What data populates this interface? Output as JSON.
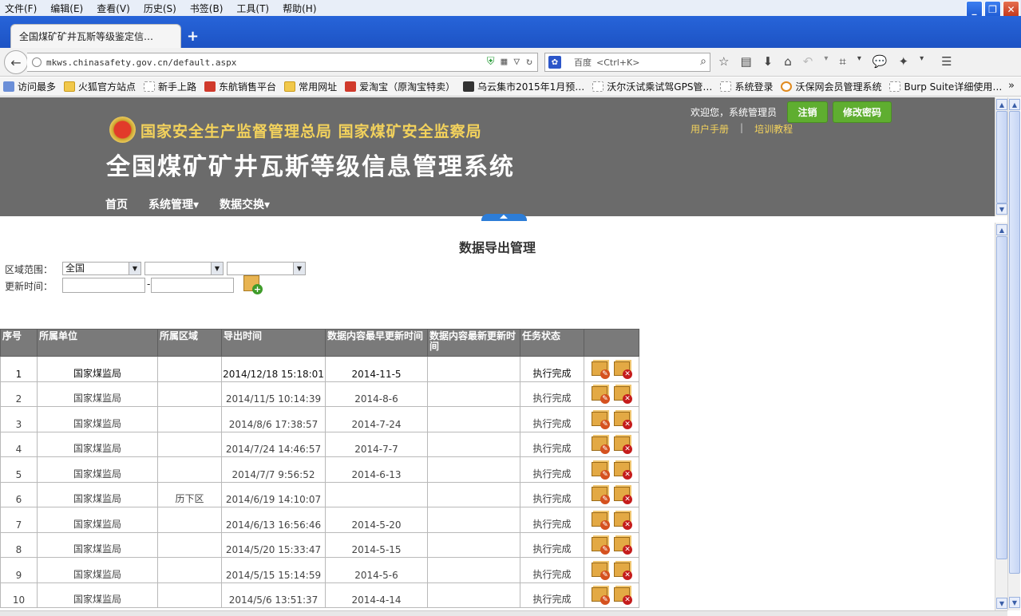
{
  "browser": {
    "menu": [
      "文件(F)",
      "编辑(E)",
      "查看(V)",
      "历史(S)",
      "书签(B)",
      "工具(T)",
      "帮助(H)"
    ],
    "tab_title": "全国煤矿矿井瓦斯等级鉴定信…",
    "url": "mkws.chinasafety.gov.cn/default.aspx",
    "search_engine": "百度",
    "search_placeholder": "<Ctrl+K>",
    "bookmarks": [
      {
        "label": "访问最多",
        "icon": "blue"
      },
      {
        "label": "火狐官方站点",
        "icon": "folder"
      },
      {
        "label": "新手上路",
        "icon": "blank"
      },
      {
        "label": "东航销售平台",
        "icon": "red"
      },
      {
        "label": "常用网址",
        "icon": "folder"
      },
      {
        "label": "爱淘宝（原淘宝特卖）",
        "icon": "red"
      },
      {
        "label": "乌云集市2015年1月预…",
        "icon": "dark"
      },
      {
        "label": "沃尔沃试乘试驾GPS管…",
        "icon": "blank"
      },
      {
        "label": "系统登录",
        "icon": "blank"
      },
      {
        "label": "沃保网会员管理系统",
        "icon": "ring"
      },
      {
        "label": "Burp Suite详细使用…",
        "icon": "blank"
      }
    ]
  },
  "header": {
    "agency": "国家安全生产监督管理总局  国家煤矿安全监察局",
    "system_title": "全国煤矿矿井瓦斯等级信息管理系统",
    "nav": [
      "首页",
      "系统管理▾",
      "数据交换▾"
    ],
    "welcome": "欢迎您，系统管理员",
    "logout": "注销",
    "change_password": "修改密码",
    "manual": "用户手册",
    "separator": "|",
    "training": "培训教程"
  },
  "filters": {
    "page_title": "数据导出管理",
    "region_label": "区域范围：",
    "region_values": [
      "全国",
      "",
      ""
    ],
    "time_label": "更新时间：",
    "date_sep": "-"
  },
  "table": {
    "headers": [
      "序号",
      "所属单位",
      "所属区域",
      "导出时间",
      "数据内容最早更新时间",
      "数据内容最新更新时间",
      "任务状态",
      ""
    ],
    "rows": [
      [
        "1",
        "国家煤监局",
        "",
        "2014/12/18 15:18:01",
        "2014-11-5",
        "",
        "执行完成"
      ],
      [
        "2",
        "国家煤监局",
        "",
        "2014/11/5 10:14:39",
        "2014-8-6",
        "",
        "执行完成"
      ],
      [
        "3",
        "国家煤监局",
        "",
        "2014/8/6 17:38:57",
        "2014-7-24",
        "",
        "执行完成"
      ],
      [
        "4",
        "国家煤监局",
        "",
        "2014/7/24 14:46:57",
        "2014-7-7",
        "",
        "执行完成"
      ],
      [
        "5",
        "国家煤监局",
        "",
        "2014/7/7 9:56:52",
        "2014-6-13",
        "",
        "执行完成"
      ],
      [
        "6",
        "国家煤监局",
        "历下区",
        "2014/6/19 14:10:07",
        "",
        "",
        "执行完成"
      ],
      [
        "7",
        "国家煤监局",
        "",
        "2014/6/13 16:56:46",
        "2014-5-20",
        "",
        "执行完成"
      ],
      [
        "8",
        "国家煤监局",
        "",
        "2014/5/20 15:33:47",
        "2014-5-15",
        "",
        "执行完成"
      ],
      [
        "9",
        "国家煤监局",
        "",
        "2014/5/15 15:14:59",
        "2014-5-6",
        "",
        "执行完成"
      ],
      [
        "10",
        "国家煤监局",
        "",
        "2014/5/6 13:51:37",
        "2014-4-14",
        "",
        "执行完成"
      ]
    ]
  },
  "icons": {
    "edit": "document-edit-icon",
    "delete": "document-delete-icon",
    "add": "document-add-icon"
  },
  "colors": {
    "header_bg": "#6b6b6b",
    "agency_text": "#f3d25c",
    "button_green": "#5fae30",
    "table_header_bg": "#7a7a7a"
  }
}
